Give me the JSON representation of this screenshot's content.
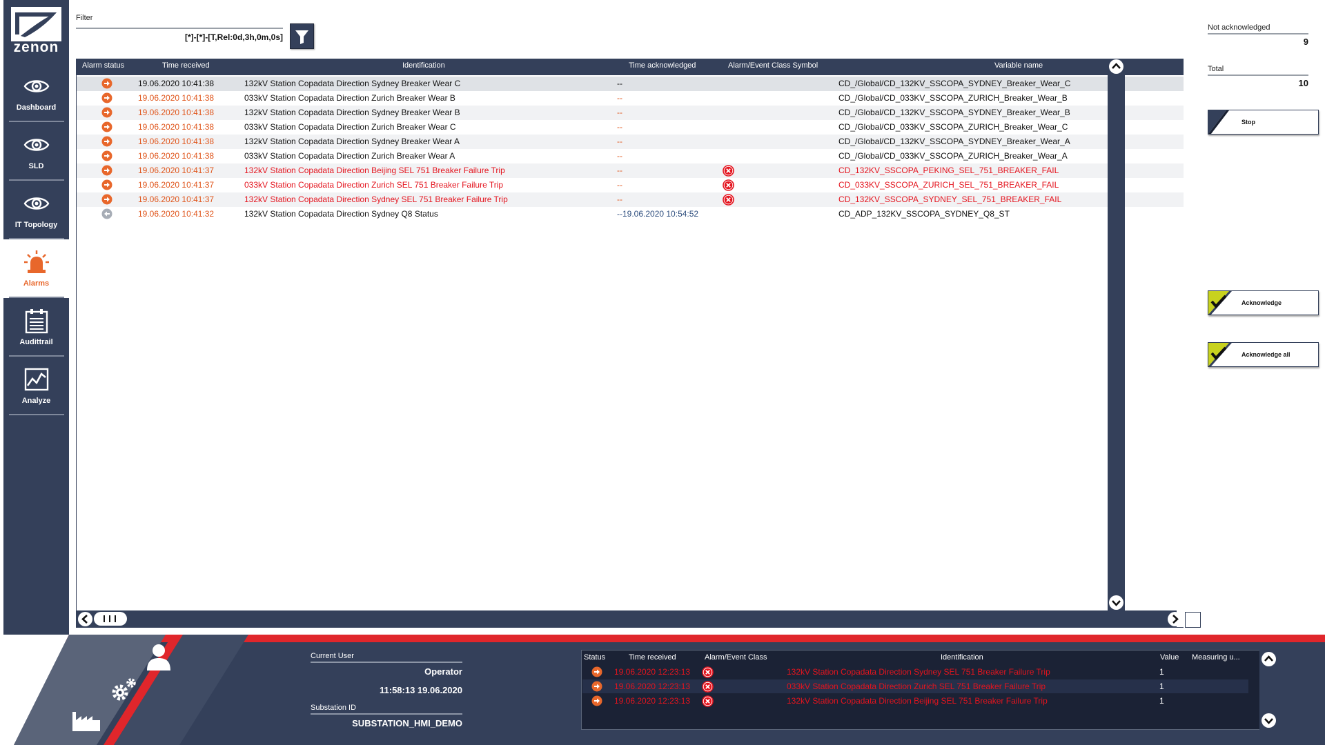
{
  "app": {
    "logo_text": "zenon"
  },
  "sidebar": {
    "items": [
      {
        "label": "Dashboard",
        "icon": "eye-icon"
      },
      {
        "label": "SLD",
        "icon": "eye-icon"
      },
      {
        "label": "IT Topology",
        "icon": "eye-icon"
      },
      {
        "label": "Alarms",
        "icon": "siren-icon",
        "active": true
      },
      {
        "label": "Audittrail",
        "icon": "clipboard-icon"
      },
      {
        "label": "Analyze",
        "icon": "chart-icon"
      }
    ]
  },
  "filter": {
    "label": "Filter",
    "value": "[*]-[*]-[T,Rel:0d,3h,0m,0s]",
    "button_icon": "funnel-icon"
  },
  "alarm_table": {
    "headers": [
      "Alarm status",
      "Time received",
      "Identification",
      "Time acknowledged",
      "Alarm/Event Class Symbol",
      "Variable name"
    ],
    "rows": [
      {
        "time_received": "19.06.2020 10:41:38",
        "identification": "132kV Station Copadata Direction Sydney Breaker Wear C",
        "time_acknowledged": "--",
        "class_symbol": "",
        "variable": "CD_/Global/CD_132KV_SSCOPA_SYDNEY_Breaker_Wear_C",
        "status_icon": "alarm-arrow-icon",
        "style": "normal"
      },
      {
        "time_received": "19.06.2020 10:41:38",
        "identification": "033kV Station Copadata Direction Zurich Breaker Wear B",
        "time_acknowledged": "--",
        "class_symbol": "",
        "variable": "CD_/Global/CD_033KV_SSCOPA_ZURICH_Breaker_Wear_B",
        "status_icon": "alarm-arrow-icon",
        "style": "normal"
      },
      {
        "time_received": "19.06.2020 10:41:38",
        "identification": "132kV Station Copadata Direction Sydney Breaker Wear B",
        "time_acknowledged": "--",
        "class_symbol": "",
        "variable": "CD_/Global/CD_132KV_SSCOPA_SYDNEY_Breaker_Wear_B",
        "status_icon": "alarm-arrow-icon",
        "style": "normal"
      },
      {
        "time_received": "19.06.2020 10:41:38",
        "identification": "033kV Station Copadata Direction Zurich Breaker Wear C",
        "time_acknowledged": "--",
        "class_symbol": "",
        "variable": "CD_/Global/CD_033KV_SSCOPA_ZURICH_Breaker_Wear_C",
        "status_icon": "alarm-arrow-icon",
        "style": "normal"
      },
      {
        "time_received": "19.06.2020 10:41:38",
        "identification": "132kV Station Copadata Direction Sydney Breaker Wear A",
        "time_acknowledged": "--",
        "class_symbol": "",
        "variable": "CD_/Global/CD_132KV_SSCOPA_SYDNEY_Breaker_Wear_A",
        "status_icon": "alarm-arrow-icon",
        "style": "normal"
      },
      {
        "time_received": "19.06.2020 10:41:38",
        "identification": "033kV Station Copadata Direction Zurich Breaker Wear A",
        "time_acknowledged": "--",
        "class_symbol": "",
        "variable": "CD_/Global/CD_033KV_SSCOPA_ZURICH_Breaker_Wear_A",
        "status_icon": "alarm-arrow-icon",
        "style": "normal"
      },
      {
        "time_received": "19.06.2020 10:41:37",
        "identification": "132kV Station Copadata Direction Beijing SEL 751 Breaker Failure Trip",
        "time_acknowledged": "--",
        "class_symbol": "error-x-icon",
        "variable": "CD_132KV_SSCOPA_PEKING_SEL_751_BREAKER_FAIL",
        "status_icon": "alarm-arrow-icon",
        "style": "critical"
      },
      {
        "time_received": "19.06.2020 10:41:37",
        "identification": "033kV Station Copadata Direction Zurich SEL 751 Breaker Failure Trip",
        "time_acknowledged": "--",
        "class_symbol": "error-x-icon",
        "variable": "CD_033KV_SSCOPA_ZURICH_SEL_751_BREAKER_FAIL",
        "status_icon": "alarm-arrow-icon",
        "style": "critical"
      },
      {
        "time_received": "19.06.2020 10:41:37",
        "identification": "132kV Station Copadata Direction Sydney SEL 751 Breaker Failure Trip",
        "time_acknowledged": "--",
        "class_symbol": "error-x-icon",
        "variable": "CD_132KV_SSCOPA_SYDNEY_SEL_751_BREAKER_FAIL",
        "status_icon": "alarm-arrow-icon",
        "style": "critical"
      },
      {
        "time_received": "19.06.2020 10:41:32",
        "identification": "132kV Station Copadata Direction Sydney Q8 Status",
        "time_acknowledged": "--19.06.2020 10:54:52",
        "class_symbol": "",
        "variable": "CD_ADP_132KV_SSCOPA_SYDNEY_Q8_ST",
        "status_icon": "gone-arrow-icon",
        "style": "acknowledged"
      }
    ]
  },
  "counters": {
    "not_acknowledged": {
      "label": "Not acknowledged",
      "value": "9"
    },
    "total": {
      "label": "Total",
      "value": "10"
    }
  },
  "buttons": {
    "stop": "Stop",
    "acknowledge": "Acknowledge",
    "acknowledge_all": "Acknowledge all"
  },
  "user_info": {
    "current_user_label": "Current User",
    "current_user": "Operator",
    "datetime": "11:58:13 19.06.2020",
    "substation_label": "Substation ID",
    "substation": "SUBSTATION_HMI_DEMO"
  },
  "active_alarms": {
    "headers": [
      "Status",
      "Time received",
      "Alarm/Event Class",
      "Identification",
      "Value",
      "Measuring u..."
    ],
    "rows": [
      {
        "time_received": "19.06.2020 12:23:13",
        "identification": "132kV Station Copadata Direction Sydney SEL 751 Breaker Failure Trip",
        "value": "1",
        "status_icon": "alarm-arrow-icon",
        "class_icon": "error-x-icon"
      },
      {
        "time_received": "19.06.2020 12:23:13",
        "identification": "033kV Station Copadata Direction Zurich SEL 751 Breaker Failure Trip",
        "value": "1",
        "status_icon": "alarm-arrow-icon",
        "class_icon": "error-x-icon"
      },
      {
        "time_received": "19.06.2020 12:23:13",
        "identification": "132kV Station Copadata Direction Beijing SEL 751 Breaker Failure Trip",
        "value": "1",
        "status_icon": "alarm-arrow-icon",
        "class_icon": "error-x-icon"
      }
    ]
  },
  "colors": {
    "nav_bg": "#34405a",
    "accent_orange": "#e8672b",
    "alarm_red": "#e4141e",
    "stripe_red": "#e0262b",
    "ack_green": "#c8d21e"
  }
}
